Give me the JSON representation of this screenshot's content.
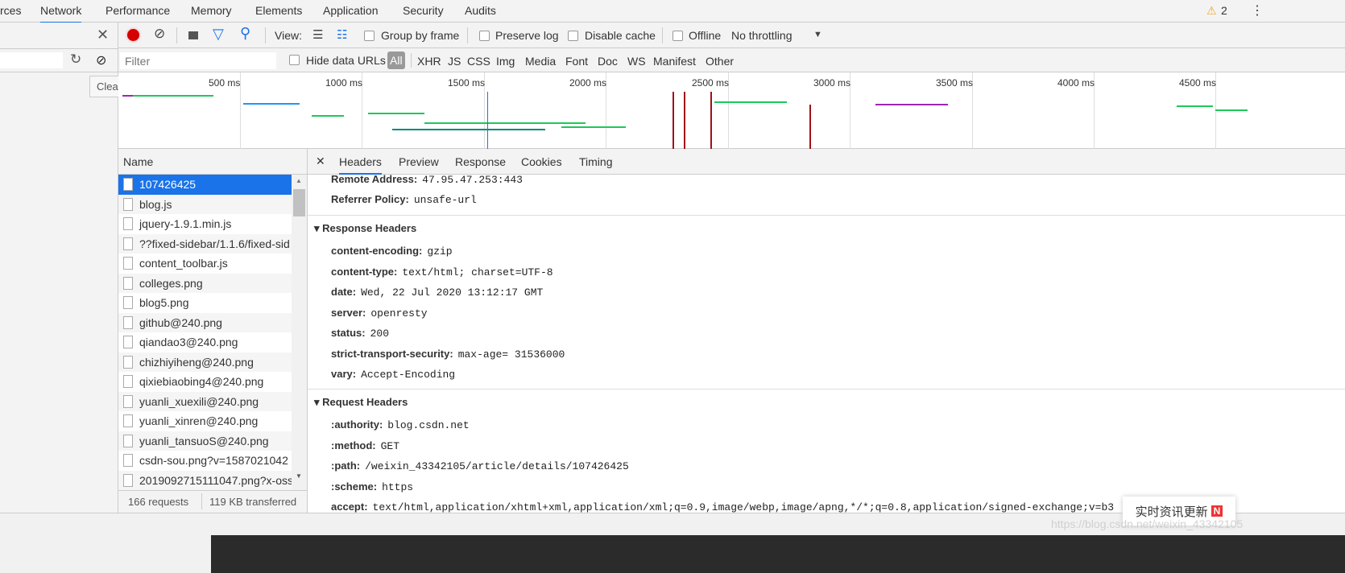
{
  "tabs": [
    "rces",
    "Network",
    "Performance",
    "Memory",
    "Elements",
    "Application",
    "Security",
    "Audits"
  ],
  "active_tab": "Network",
  "warning_count": "2",
  "toolbar": {
    "view_label": "View:",
    "group_by_frame": "Group by frame",
    "preserve_log": "Preserve log",
    "disable_cache": "Disable cache",
    "offline": "Offline",
    "throttling": "No throttling"
  },
  "filter": {
    "placeholder": "Filter",
    "hide_data_urls": "Hide data URLs",
    "types": [
      "All",
      "XHR",
      "JS",
      "CSS",
      "Img",
      "Media",
      "Font",
      "Doc",
      "WS",
      "Manifest",
      "Other"
    ]
  },
  "tooltip": "Clear",
  "timeline": {
    "ticks": [
      "500 ms",
      "1000 ms",
      "1500 ms",
      "2000 ms",
      "2500 ms",
      "3000 ms",
      "3500 ms",
      "4000 ms",
      "4500 ms"
    ]
  },
  "name_header": "Name",
  "requests": [
    "107426425",
    "blog.js",
    "jquery-1.9.1.min.js",
    "??fixed-sidebar/1.1.6/fixed-sid",
    "content_toolbar.js",
    "colleges.png",
    "blog5.png",
    "github@240.png",
    "qiandao3@240.png",
    "chizhiyiheng@240.png",
    "qixiebiaobing4@240.png",
    "yuanli_xuexili@240.png",
    "yuanli_xinren@240.png",
    "yuanli_tansuoS@240.png",
    "csdn-sou.png?v=1587021042",
    "2019092715111047.png?x-oss"
  ],
  "status": {
    "requests": "166 requests",
    "transferred": "119 KB transferred"
  },
  "detail_tabs": [
    "Headers",
    "Preview",
    "Response",
    "Cookies",
    "Timing"
  ],
  "general": [
    {
      "k": "Remote Address:",
      "v": "47.95.47.253:443"
    },
    {
      "k": "Referrer Policy:",
      "v": "unsafe-url"
    }
  ],
  "response_title": "Response Headers",
  "response_headers": [
    {
      "k": "content-encoding:",
      "v": "gzip"
    },
    {
      "k": "content-type:",
      "v": "text/html; charset=UTF-8"
    },
    {
      "k": "date:",
      "v": "Wed, 22 Jul 2020 13:12:17 GMT"
    },
    {
      "k": "server:",
      "v": "openresty"
    },
    {
      "k": "status:",
      "v": "200"
    },
    {
      "k": "strict-transport-security:",
      "v": "max-age= 31536000"
    },
    {
      "k": "vary:",
      "v": "Accept-Encoding"
    }
  ],
  "request_title": "Request Headers",
  "request_headers": [
    {
      "k": ":authority:",
      "v": "blog.csdn.net"
    },
    {
      "k": ":method:",
      "v": "GET"
    },
    {
      "k": ":path:",
      "v": "/weixin_43342105/article/details/107426425"
    },
    {
      "k": ":scheme:",
      "v": "https"
    },
    {
      "k": "accept:",
      "v": "text/html,application/xhtml+xml,application/xml;q=0.9,image/webp,image/apng,*/*;q=0.8,application/signed-exchange;v=b3"
    }
  ],
  "popup": {
    "text": "实时资讯更新",
    "badge": "N"
  },
  "watermark": "https://blog.csdn.net/weixin_43342105",
  "colors": {
    "accent": "#1a73e8",
    "record": "#d50000",
    "waterfall_green": "#1ec85a",
    "waterfall_purple": "#9c27b0",
    "waterfall_orange": "#f5a623",
    "load_line": "#a0111a"
  }
}
